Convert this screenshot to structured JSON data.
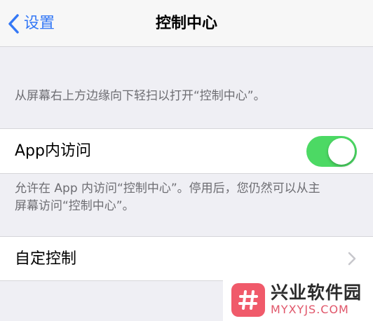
{
  "nav": {
    "back_label": "设置",
    "title": "控制中心"
  },
  "intro": {
    "text": "从屏幕右上方边缘向下轻扫以打开“控制中心”。"
  },
  "access_in_apps": {
    "label": "App内访问",
    "enabled": true
  },
  "access_desc": {
    "line1": "允许在 App 内访问“控制中心”。停用后，您仍然可以从主",
    "line2": "屏幕访问“控制中心”。"
  },
  "customize": {
    "label": "自定控制"
  },
  "watermark": {
    "name": "兴业软件园",
    "url": "MYXYJS.COM"
  },
  "colors": {
    "accent": "#3478f6",
    "switch_on": "#4cd964",
    "background": "#efeff4"
  },
  "icons": {
    "back": "chevron-left-icon",
    "disclosure": "chevron-right-icon"
  }
}
